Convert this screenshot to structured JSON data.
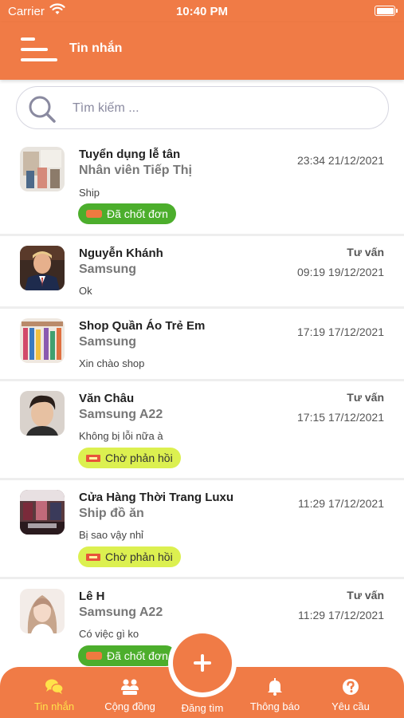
{
  "status_bar": {
    "carrier": "Carrier",
    "time": "10:40 PM"
  },
  "header": {
    "title": "Tin nhắn"
  },
  "search": {
    "placeholder": "Tìm kiếm ..."
  },
  "conversations": [
    {
      "name": "Tuyển dụng lễ tân",
      "product": "Nhân viên Tiếp Thị",
      "message": "Ship",
      "tag": "",
      "time": "23:34 21/12/2021",
      "status": "Đã chốt đơn"
    },
    {
      "name": "Nguyễn Khánh",
      "product": "Samsung",
      "message": "Ok",
      "tag": "Tư vấn",
      "time": "09:19 19/12/2021",
      "status": ""
    },
    {
      "name": "Shop Quần Áo Trẻ Em",
      "product": "Samsung",
      "message": "Xin chào shop",
      "tag": "",
      "time": "17:19 17/12/2021",
      "status": ""
    },
    {
      "name": "Văn Châu",
      "product": "Samsung A22",
      "message": "Không bị lỗi nữa à",
      "tag": "Tư vấn",
      "time": "17:15 17/12/2021",
      "status": "Chờ phản hồi"
    },
    {
      "name": "Cửa Hàng Thời Trang Luxu",
      "product": "Ship đồ ăn",
      "message": "Bị sao vậy nhỉ",
      "tag": "",
      "time": "11:29 17/12/2021",
      "status": "Chờ phản hồi"
    },
    {
      "name": "Lê H",
      "product": "Samsung A22",
      "message": "Có việc gì ko",
      "tag": "Tư vấn",
      "time": "11:29 17/12/2021",
      "status": "Đã chốt đơn"
    }
  ],
  "tabbar": {
    "tabs": [
      {
        "label": "Tin nhắn",
        "icon": "chat-bubbles-icon",
        "active": true
      },
      {
        "label": "Cộng đồng",
        "icon": "community-icon",
        "active": false
      },
      {
        "label": "Đăng tìm",
        "icon": "plus-icon",
        "active": false
      },
      {
        "label": "Thông báo",
        "icon": "bell-icon",
        "active": false
      },
      {
        "label": "Yêu cầu",
        "icon": "question-icon",
        "active": false
      }
    ]
  },
  "colors": {
    "brand": "#f07b46",
    "done_badge": "#4cae2c",
    "wait_badge": "#dcf050",
    "active_tab": "#ffe24a"
  }
}
